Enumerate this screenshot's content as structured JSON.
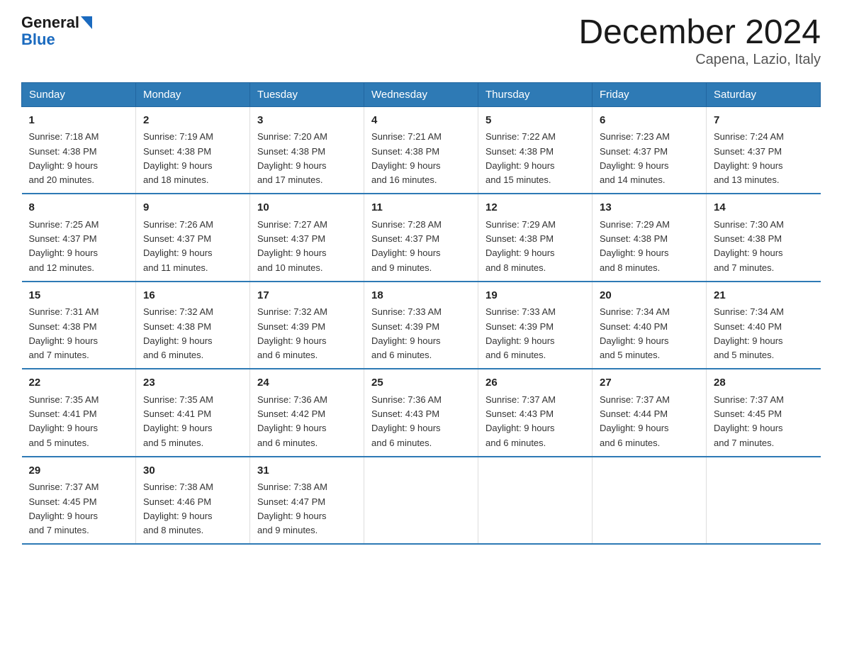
{
  "header": {
    "logo_line1": "General",
    "logo_line2": "Blue",
    "title": "December 2024",
    "subtitle": "Capena, Lazio, Italy"
  },
  "weekdays": [
    "Sunday",
    "Monday",
    "Tuesday",
    "Wednesday",
    "Thursday",
    "Friday",
    "Saturday"
  ],
  "weeks": [
    [
      {
        "day": "1",
        "sunrise": "7:18 AM",
        "sunset": "4:38 PM",
        "daylight": "9 hours and 20 minutes."
      },
      {
        "day": "2",
        "sunrise": "7:19 AM",
        "sunset": "4:38 PM",
        "daylight": "9 hours and 18 minutes."
      },
      {
        "day": "3",
        "sunrise": "7:20 AM",
        "sunset": "4:38 PM",
        "daylight": "9 hours and 17 minutes."
      },
      {
        "day": "4",
        "sunrise": "7:21 AM",
        "sunset": "4:38 PM",
        "daylight": "9 hours and 16 minutes."
      },
      {
        "day": "5",
        "sunrise": "7:22 AM",
        "sunset": "4:38 PM",
        "daylight": "9 hours and 15 minutes."
      },
      {
        "day": "6",
        "sunrise": "7:23 AM",
        "sunset": "4:37 PM",
        "daylight": "9 hours and 14 minutes."
      },
      {
        "day": "7",
        "sunrise": "7:24 AM",
        "sunset": "4:37 PM",
        "daylight": "9 hours and 13 minutes."
      }
    ],
    [
      {
        "day": "8",
        "sunrise": "7:25 AM",
        "sunset": "4:37 PM",
        "daylight": "9 hours and 12 minutes."
      },
      {
        "day": "9",
        "sunrise": "7:26 AM",
        "sunset": "4:37 PM",
        "daylight": "9 hours and 11 minutes."
      },
      {
        "day": "10",
        "sunrise": "7:27 AM",
        "sunset": "4:37 PM",
        "daylight": "9 hours and 10 minutes."
      },
      {
        "day": "11",
        "sunrise": "7:28 AM",
        "sunset": "4:37 PM",
        "daylight": "9 hours and 9 minutes."
      },
      {
        "day": "12",
        "sunrise": "7:29 AM",
        "sunset": "4:38 PM",
        "daylight": "9 hours and 8 minutes."
      },
      {
        "day": "13",
        "sunrise": "7:29 AM",
        "sunset": "4:38 PM",
        "daylight": "9 hours and 8 minutes."
      },
      {
        "day": "14",
        "sunrise": "7:30 AM",
        "sunset": "4:38 PM",
        "daylight": "9 hours and 7 minutes."
      }
    ],
    [
      {
        "day": "15",
        "sunrise": "7:31 AM",
        "sunset": "4:38 PM",
        "daylight": "9 hours and 7 minutes."
      },
      {
        "day": "16",
        "sunrise": "7:32 AM",
        "sunset": "4:38 PM",
        "daylight": "9 hours and 6 minutes."
      },
      {
        "day": "17",
        "sunrise": "7:32 AM",
        "sunset": "4:39 PM",
        "daylight": "9 hours and 6 minutes."
      },
      {
        "day": "18",
        "sunrise": "7:33 AM",
        "sunset": "4:39 PM",
        "daylight": "9 hours and 6 minutes."
      },
      {
        "day": "19",
        "sunrise": "7:33 AM",
        "sunset": "4:39 PM",
        "daylight": "9 hours and 6 minutes."
      },
      {
        "day": "20",
        "sunrise": "7:34 AM",
        "sunset": "4:40 PM",
        "daylight": "9 hours and 5 minutes."
      },
      {
        "day": "21",
        "sunrise": "7:34 AM",
        "sunset": "4:40 PM",
        "daylight": "9 hours and 5 minutes."
      }
    ],
    [
      {
        "day": "22",
        "sunrise": "7:35 AM",
        "sunset": "4:41 PM",
        "daylight": "9 hours and 5 minutes."
      },
      {
        "day": "23",
        "sunrise": "7:35 AM",
        "sunset": "4:41 PM",
        "daylight": "9 hours and 5 minutes."
      },
      {
        "day": "24",
        "sunrise": "7:36 AM",
        "sunset": "4:42 PM",
        "daylight": "9 hours and 6 minutes."
      },
      {
        "day": "25",
        "sunrise": "7:36 AM",
        "sunset": "4:43 PM",
        "daylight": "9 hours and 6 minutes."
      },
      {
        "day": "26",
        "sunrise": "7:37 AM",
        "sunset": "4:43 PM",
        "daylight": "9 hours and 6 minutes."
      },
      {
        "day": "27",
        "sunrise": "7:37 AM",
        "sunset": "4:44 PM",
        "daylight": "9 hours and 6 minutes."
      },
      {
        "day": "28",
        "sunrise": "7:37 AM",
        "sunset": "4:45 PM",
        "daylight": "9 hours and 7 minutes."
      }
    ],
    [
      {
        "day": "29",
        "sunrise": "7:37 AM",
        "sunset": "4:45 PM",
        "daylight": "9 hours and 7 minutes."
      },
      {
        "day": "30",
        "sunrise": "7:38 AM",
        "sunset": "4:46 PM",
        "daylight": "9 hours and 8 minutes."
      },
      {
        "day": "31",
        "sunrise": "7:38 AM",
        "sunset": "4:47 PM",
        "daylight": "9 hours and 9 minutes."
      },
      null,
      null,
      null,
      null
    ]
  ]
}
